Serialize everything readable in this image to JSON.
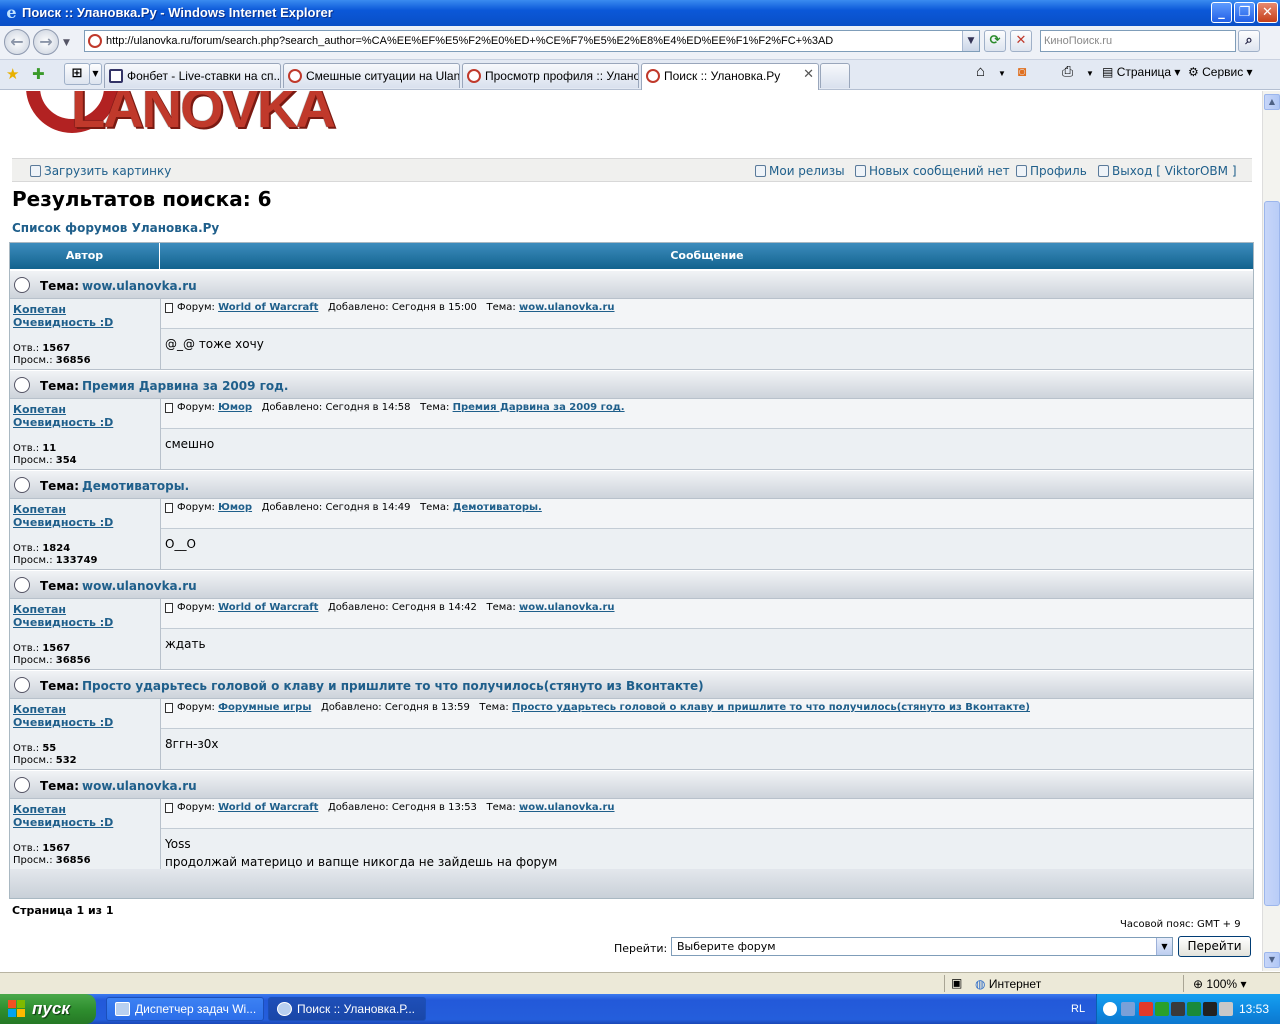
{
  "window": {
    "title": "Поиск :: Улановка.Ру - Windows Internet Explorer",
    "url": "http://ulanovka.ru/forum/search.php?search_author=%CA%EE%EF%E5%F2%E0%ED+%CE%F7%E5%E2%E8%E4%ED%EE%F1%F2%FC+%3AD",
    "search_placeholder": "КиноПоиск.ru"
  },
  "tabs": [
    {
      "label": "Фонбет - Live-ставки на сп..."
    },
    {
      "label": "Смешные ситуации на Ulan..."
    },
    {
      "label": "Просмотр профиля :: Улано..."
    },
    {
      "label": "Поиск :: Улановка.Ру"
    }
  ],
  "toolbar": {
    "page_label": "Страница",
    "tools_label": "Сервис"
  },
  "site": {
    "logo_text": "LANOVKA",
    "nav": {
      "upload": "Загрузить картинку",
      "releases": "Мои релизы",
      "new_posts": "Новых сообщений нет",
      "profile": "Профиль",
      "logout": "Выход [ ViktorOBM ]"
    },
    "results_title": "Результатов поиска: 6",
    "breadcrumb": "Список форумов Улановка.Ру",
    "columns": {
      "author": "Автор",
      "message": "Сообщение"
    }
  },
  "labels": {
    "topic": "Тема:",
    "forum": "Форум:",
    "added": "Добавлено:",
    "replies": "Отв.:",
    "views": "Просм.:"
  },
  "results": [
    {
      "topic": "wow.ulanovka.ru",
      "author": [
        "Копетан",
        "Очевидность :D"
      ],
      "forum": "World of Warcraft",
      "added": "Сегодня в 15:00",
      "replies": "1567",
      "views": "36856",
      "message": "@_@ тоже хочу"
    },
    {
      "topic": "Премия Дарвина за 2009 год.",
      "author": [
        "Копетан",
        "Очевидность :D"
      ],
      "forum": "Юмор",
      "added": "Сегодня в 14:58",
      "replies": "11",
      "views": "354",
      "message": "смешно"
    },
    {
      "topic": "Демотиваторы.",
      "author": [
        "Копетан",
        "Очевидность :D"
      ],
      "forum": "Юмор",
      "added": "Сегодня в 14:49",
      "replies": "1824",
      "views": "133749",
      "message": "O__O"
    },
    {
      "topic": "wow.ulanovka.ru",
      "author": [
        "Копетан",
        "Очевидность :D"
      ],
      "forum": "World of Warcraft",
      "added": "Сегодня в 14:42",
      "replies": "1567",
      "views": "36856",
      "message": "ждать"
    },
    {
      "topic": "Просто ударьтесь головой о клаву и пришлите то что получилось(стянуто из Вконтакте)",
      "author": [
        "Копетан",
        "Очевидность :D"
      ],
      "forum": "Форумные игры",
      "added": "Сегодня в 13:59",
      "replies": "55",
      "views": "532",
      "message": "8ггн-з0х"
    },
    {
      "topic": "wow.ulanovka.ru",
      "author": [
        "Копетан",
        "Очевидность :D"
      ],
      "forum": "World of Warcraft",
      "added": "Сегодня в 13:53",
      "replies": "1567",
      "views": "36856",
      "message": "Yoss\nпродолжай материцо и вапще никогда не зайдешь на форум"
    }
  ],
  "footer": {
    "pager": "Страница 1 из 1",
    "timezone": "Часовой пояс: GMT + 9",
    "jump_label": "Перейти:",
    "jump_value": "Выберите форум",
    "jump_button": "Перейти"
  },
  "statusbar": {
    "zone": "Интернет",
    "zoom": "100%"
  },
  "taskbar": {
    "start": "пуск",
    "items": [
      {
        "label": "Диспетчер задач Wi..."
      },
      {
        "label": "Поиск :: Улановка.Р..."
      }
    ],
    "lang": "RL",
    "clock": "13:53"
  },
  "colors": {
    "link": "#1f5f8b",
    "header": "#12638e",
    "titlebar": "#0b58d8",
    "start": "#2f8f2f"
  }
}
